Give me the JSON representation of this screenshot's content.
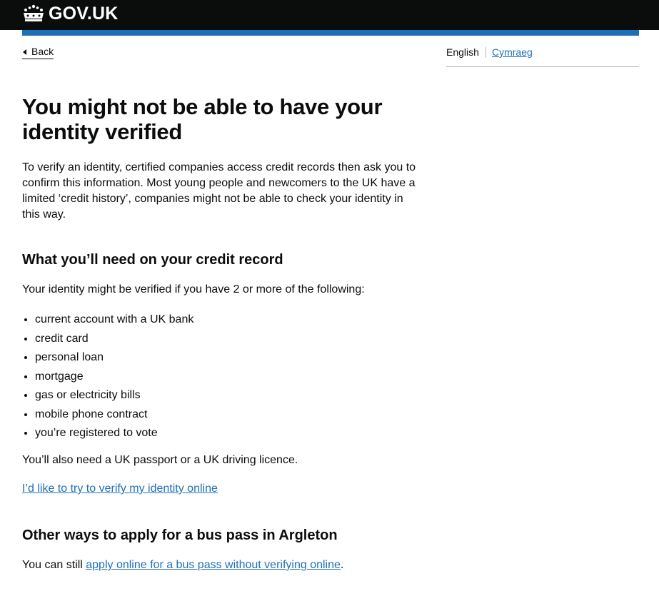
{
  "header": {
    "logo_text": "GOV.UK",
    "logo_icon": "crown-icon"
  },
  "nav": {
    "back_label": "Back"
  },
  "language": {
    "current": "English",
    "other": "Cymraeg"
  },
  "main": {
    "title": "You might not be able to have your identity verified",
    "intro": "To verify an identity, certified companies access credit records then ask you to confirm this information. Most young people and newcomers to the UK have a limited ‘credit history’, companies might not be able to check your identity in this way.",
    "section1_heading": "What you’ll need on your credit record",
    "section1_lead": "Your identity might be verified if you have 2 or more of the following:",
    "items": [
      "current account with a UK bank",
      "credit card",
      "personal loan",
      "mortgage",
      "gas or electricity bills",
      "mobile phone contract",
      "you’re registered to vote"
    ],
    "also_need": "You’ll also need a UK passport or a UK driving licence.",
    "verify_link": "I’d like to try to verify my identity online",
    "section2_heading": "Other ways to apply for a bus pass in Argleton",
    "still_prefix": "You can still ",
    "still_link": "apply online for a bus pass without verifying online",
    "still_suffix": "."
  },
  "colors": {
    "header_bg": "#0b0c0c",
    "brand_blue": "#1d70b8",
    "text": "#0b0c0c",
    "border": "#b1b4b6"
  }
}
